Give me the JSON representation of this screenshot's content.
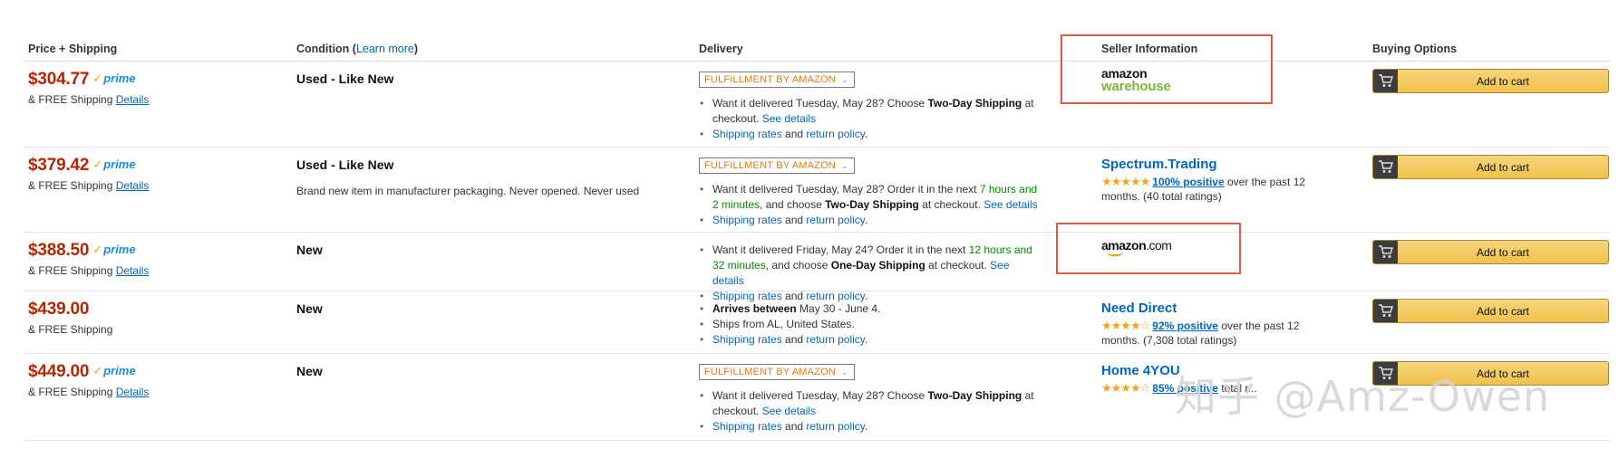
{
  "headers": {
    "price": "Price + Shipping",
    "condition": "Condition (",
    "condition_link": "Learn more",
    "condition_close": ")",
    "delivery": "Delivery",
    "seller": "Seller Information",
    "buying": "Buying Options"
  },
  "common": {
    "free_shipping": "& FREE Shipping",
    "details": "Details",
    "prime": "prime",
    "fba": "FULFILLMENT BY AMAZON",
    "add_to_cart": "Add to cart",
    "shipping_rates": "Shipping rates",
    "and": " and ",
    "return_policy": "return policy",
    "period": "."
  },
  "offers": [
    {
      "price": "$304.77",
      "condition": "Used - Like New",
      "del1": {
        "a": "Want it delivered Tuesday, May 28? Choose ",
        "b": "Two-Day Shipping",
        "c": " at checkout. ",
        "link": "See details"
      },
      "seller_logo": {
        "amazon": "amazon",
        "warehouse": "warehouse"
      }
    },
    {
      "price": "$379.42",
      "condition": "Used - Like New",
      "note": "Brand new item in manufacturer packaging. Never opened. Never used",
      "del1": {
        "a": "Want it delivered Tuesday, May 28? Order it in the next ",
        "g": "7 hours and 2 minutes",
        "m": ", and choose ",
        "b": "Two-Day Shipping",
        "c": " at checkout. ",
        "link": "See details"
      },
      "seller": {
        "name": "Spectrum.Trading",
        "stars": "★★★★★",
        "positive": "100% positive",
        "text": " over the past 12 months. (40 total ratings)"
      }
    },
    {
      "price": "$388.50",
      "condition": "New",
      "del1": {
        "a": "Want it delivered Friday, May 24? Order it in the next ",
        "g": "12 hours and 32 minutes",
        "m": ", and choose ",
        "b": "One-Day Shipping",
        "c": " at checkout. ",
        "link": "See details"
      },
      "seller_logo": {
        "amazon": "amazon",
        "com": ".com"
      }
    },
    {
      "price": "$439.00",
      "condition": "New",
      "arrives": {
        "b": "Arrives between",
        "rest": " May 30 - June 4."
      },
      "ships_from": "Ships from AL, United States.",
      "seller": {
        "name": "Need Direct",
        "stars": "★★★★☆",
        "positive": "92% positive",
        "text": " over the past 12 months. (7,308 total ratings)"
      }
    },
    {
      "price": "$449.00",
      "condition": "New",
      "del1": {
        "a": "Want it delivered Tuesday, May 28? Choose ",
        "b": "Two-Day Shipping",
        "c": " at checkout. ",
        "link": "See details"
      },
      "seller": {
        "name": "Home 4YOU",
        "stars": "★★★★☆",
        "positive": "85% positive",
        "text": " total r..."
      }
    }
  ],
  "watermark": "知乎 @Amz-Owen",
  "colors": {
    "price": "#b12704",
    "link": "#0066c0",
    "button": "#f0c14b",
    "highlight": "#e05b47",
    "green": "#008a00"
  }
}
